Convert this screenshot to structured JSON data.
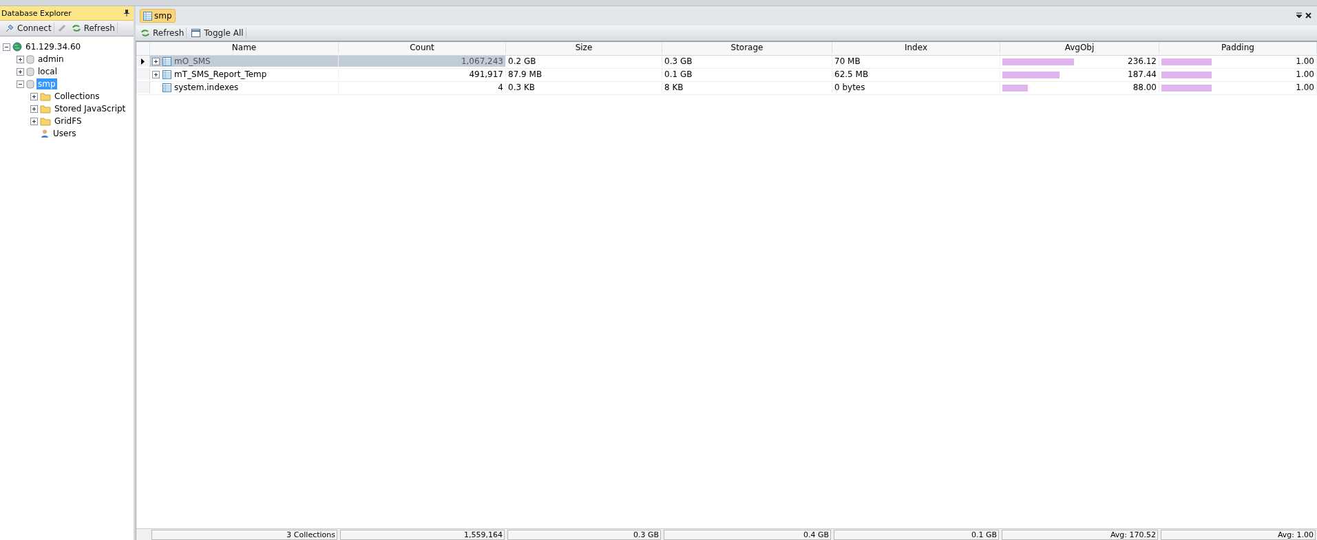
{
  "sidebar": {
    "title": "Database Explorer",
    "toolbar": [
      "Connect",
      "Refresh"
    ],
    "tree": [
      {
        "label": "61.129.34.60",
        "kind": "server",
        "expanded": true,
        "selected": false,
        "children": [
          {
            "label": "admin",
            "kind": "database",
            "expanded": false,
            "selected": false
          },
          {
            "label": "local",
            "kind": "database",
            "expanded": false,
            "selected": false
          },
          {
            "label": "smp",
            "kind": "database",
            "expanded": true,
            "selected": true,
            "children": [
              {
                "label": "Collections",
                "kind": "folder",
                "expanded": false,
                "selected": false
              },
              {
                "label": "Stored JavaScript",
                "kind": "folder",
                "expanded": false,
                "selected": false
              },
              {
                "label": "GridFS",
                "kind": "folder",
                "expanded": false,
                "selected": false
              },
              {
                "label": "Users",
                "kind": "users",
                "selected": false
              }
            ]
          }
        ]
      }
    ]
  },
  "document_tab": {
    "label": "smp"
  },
  "toolbar": [
    "Refresh",
    "Toggle All"
  ],
  "table": {
    "columns": [
      "Name",
      "Count",
      "Size",
      "Storage",
      "Index",
      "AvgObj",
      "Padding"
    ],
    "rows": [
      {
        "selected": true,
        "expandable": true,
        "name": "mO_SMS",
        "count": "1,067,243",
        "size": "0.2 GB",
        "storage": "0.3 GB",
        "index": "70 MB",
        "avgobj": {
          "level": 0.45,
          "reading": "236.12"
        },
        "padding": {
          "level": 0.32,
          "reading": "1.00"
        }
      },
      {
        "selected": false,
        "expandable": true,
        "name": "mT_SMS_Report_Temp",
        "count": "491,917",
        "size": "87.9 MB",
        "storage": "0.1 GB",
        "index": "62.5 MB",
        "avgobj": {
          "level": 0.36,
          "reading": "187.44"
        },
        "padding": {
          "level": 0.32,
          "reading": "1.00"
        }
      },
      {
        "selected": false,
        "expandable": false,
        "name": "system.indexes",
        "count": "4",
        "size": "0.3 KB",
        "storage": "8 KB",
        "index": "0 bytes",
        "avgobj": {
          "level": 0.16,
          "reading": "88.00"
        },
        "padding": {
          "level": 0.32,
          "reading": "1.00"
        }
      }
    ],
    "summary": [
      "3 Collections",
      "1,559,164",
      "0.3 GB",
      "0.4 GB",
      "0.1 GB",
      "Avg: 170.52",
      "Avg: 1.00"
    ]
  }
}
